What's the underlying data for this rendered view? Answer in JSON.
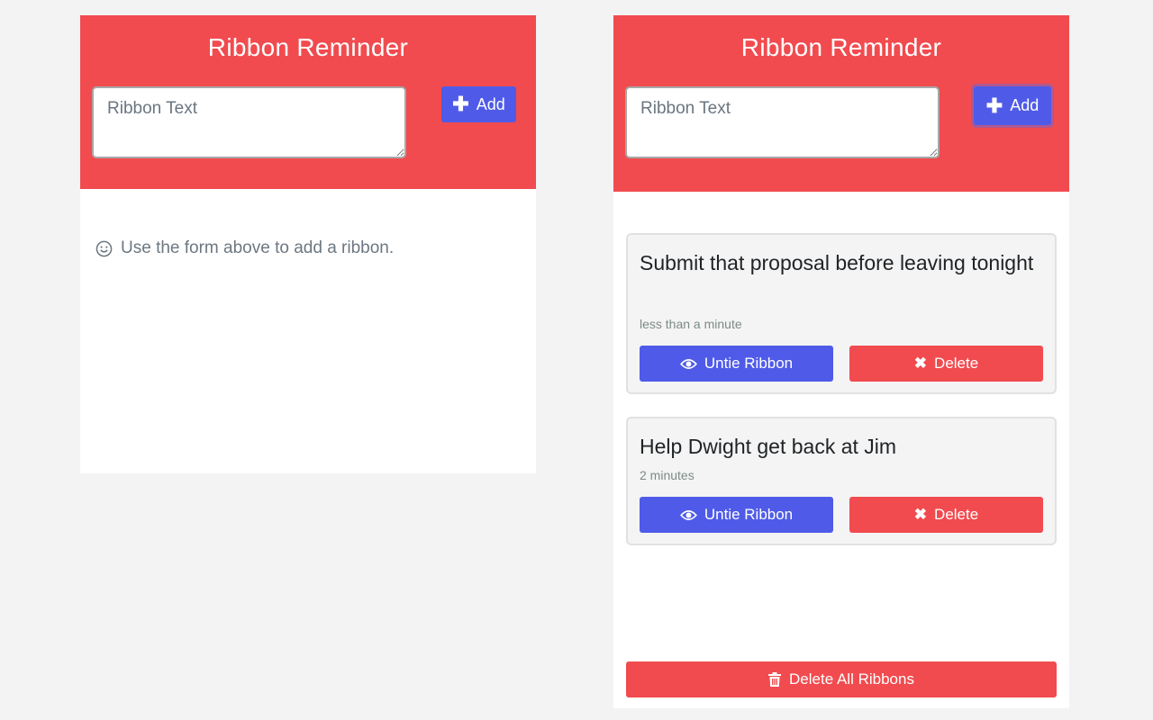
{
  "left_panel": {
    "title": "Ribbon Reminder",
    "input": {
      "placeholder": "Ribbon Text",
      "value": ""
    },
    "add_label": "Add",
    "empty_message": "Use the form above to add a ribbon."
  },
  "right_panel": {
    "title": "Ribbon Reminder",
    "input": {
      "placeholder": "Ribbon Text",
      "value": ""
    },
    "add_label": "Add",
    "ribbons": [
      {
        "text": "Submit that proposal before leaving tonight",
        "time": "less than a minute",
        "untie_label": "Untie Ribbon",
        "delete_label": "Delete"
      },
      {
        "text": "Help Dwight get back at Jim",
        "time": "2 minutes",
        "untie_label": "Untie Ribbon",
        "delete_label": "Delete"
      }
    ],
    "delete_all_label": "Delete All Ribbons"
  },
  "colors": {
    "header": "#f14b4f",
    "primary": "#4f5be8",
    "danger": "#f14b4f",
    "background": "#f3f3f3"
  },
  "icons": {
    "add": "plus-icon",
    "empty": "smile-icon",
    "untie": "eye-icon",
    "delete": "x-icon",
    "delete_all": "trash-icon"
  }
}
